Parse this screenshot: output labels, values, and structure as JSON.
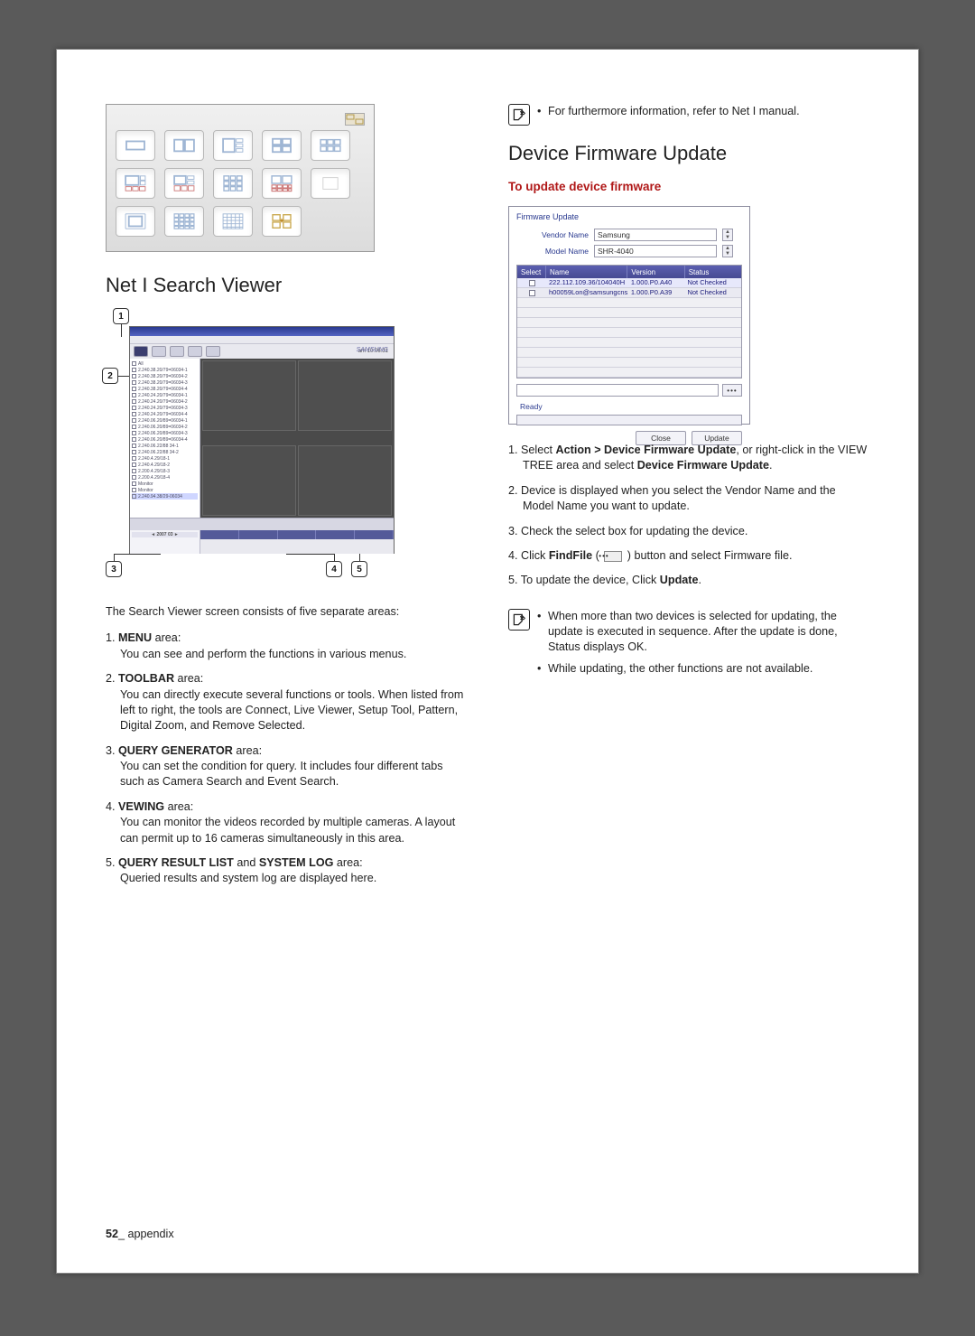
{
  "left": {
    "section_title": "Net I Search Viewer",
    "intro": "The Search Viewer screen consists of five separate areas:",
    "items": [
      {
        "num": "1.",
        "label": "MENU",
        "label_suffix": " area:",
        "desc": "You can see and perform the functions in various menus."
      },
      {
        "num": "2.",
        "label": "TOOLBAR",
        "label_suffix": " area:",
        "desc": "You can directly execute several functions or tools. When listed from left to right, the tools are Connect, Live Viewer, Setup Tool, Pattern, Digital Zoom, and Remove Selected."
      },
      {
        "num": "3.",
        "label": "QUERY GENERATOR",
        "label_suffix": " area:",
        "desc": "You can set the condition for query. It includes four different tabs such as Camera Search and Event Search."
      },
      {
        "num": "4.",
        "label": "VEWING",
        "label_suffix": " area:",
        "desc": "You can monitor the videos recorded by multiple cameras. A layout can permit up to 16 cameras simultaneously in this area."
      },
      {
        "num": "5.",
        "label": "QUERY RESULT LIST",
        "label_rest": " and ",
        "label2": "SYSTEM LOG",
        "label_suffix": " area:",
        "desc": "Queried results and system log are displayed here."
      }
    ],
    "callouts": {
      "c1": "1",
      "c2": "2",
      "c3": "3",
      "c4": "4",
      "c5": "5"
    },
    "sv": {
      "toolbar_time": "am 10:06:31",
      "logo": "SAMSUNG",
      "cal_hdr": "◄    2007   03    ►",
      "tree_nodes": [
        "All",
        "2.240.38.20/79=06034-1",
        "2.240.38.20/79=06034-2",
        "2.240.38.20/79=06034-3",
        "2.240.38.20/79=06034-4",
        "2.240.24.20/79=06034-1",
        "2.240.24.20/79=06034-2",
        "2.240.24.20/79=06034-3",
        "2.240.24.20/79=06034-4",
        "2.240.06.20/89=06034-1",
        "2.240.06.20/89=06034-2",
        "2.240.06.20/89=06034-3",
        "2.240.06.20/89=06034-4",
        "2.240.06.22/88 34-1",
        "2.240.06.22/88 34-2",
        "2.240.4.29/18-1",
        "2.240.4.29/18-2",
        "2.200.4.29/18-3",
        "2.200.4.29/18-4",
        "Monitor",
        "Monitor",
        "2.240.94.38/29-06034"
      ]
    }
  },
  "right": {
    "note_top": "For furthermore information, refer to Net I manual.",
    "section_title": "Device Firmware Update",
    "subheading": "To update device firmware",
    "dialog": {
      "title": "Firmware Update",
      "vendor_label": "Vendor Name",
      "model_label": "Model Name",
      "vendor_value": "Samsung",
      "model_value": "SHR-4040",
      "thead": {
        "select": "Select",
        "name": "Name",
        "version": "Version",
        "status": "Status"
      },
      "rows": [
        {
          "name": "222.112.109.36/104040H",
          "version": "1.000.P0.A40",
          "status": "Not Checked"
        },
        {
          "name": "h00059Lon@samsungcns...",
          "version": "1.000.P0.A39",
          "status": "Not Checked"
        }
      ],
      "findfile": "•••",
      "status_text": "Ready",
      "close": "Close",
      "update": "Update"
    },
    "steps": [
      {
        "num": "1.",
        "pieces": [
          {
            "t": "Select ",
            "b": false
          },
          {
            "t": "Action > Device Firmware Update",
            "b": true
          },
          {
            "t": ", or right-click in the VIEW TREE area and select ",
            "b": false
          },
          {
            "t": "Device Firmware Update",
            "b": true
          },
          {
            "t": ".",
            "b": false
          }
        ]
      },
      {
        "num": "2.",
        "text": "Device is displayed when you select the Vendor Name and the Model Name you want to update."
      },
      {
        "num": "3.",
        "text": "Check the select box for updating the device."
      },
      {
        "num": "4.",
        "pieces": [
          {
            "t": "Click ",
            "b": false
          },
          {
            "t": "FindFile",
            "b": true
          },
          {
            "t": " ( ",
            "b": false
          },
          {
            "icon": "findfile"
          },
          {
            "t": " ) button and select Firmware file.",
            "b": false
          }
        ]
      },
      {
        "num": "5.",
        "pieces": [
          {
            "t": "To update the device, Click ",
            "b": false
          },
          {
            "t": "Update",
            "b": true
          },
          {
            "t": ".",
            "b": false
          }
        ]
      }
    ],
    "note_bottom": [
      "When more than two devices is selected for updating, the update is executed in sequence. After the update is done, Status displays OK.",
      "While updating, the other functions are not available."
    ]
  },
  "footer": {
    "page": "52",
    "label": "_ appendix"
  }
}
